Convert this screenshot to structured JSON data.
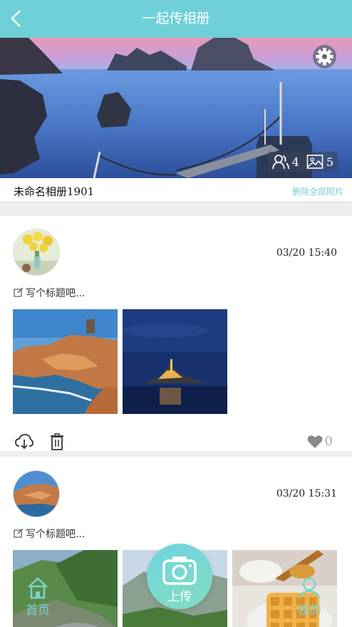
{
  "header": {
    "title": "一起传相册"
  },
  "album": {
    "member_count": "4",
    "photo_count": "5",
    "name": "未命名相册1901",
    "delete_all_label": "删除全部照片"
  },
  "posts": [
    {
      "time": "03/20 15:40",
      "title_placeholder": "写个标题吧...",
      "like_count": "0"
    },
    {
      "time": "03/20 15:31",
      "title_placeholder": "写个标题吧..."
    }
  ],
  "bottom_nav": {
    "home_label": "首页",
    "upload_label": "上传",
    "mine_label": "我的"
  },
  "colors": {
    "accent": "#6fd0d8",
    "link": "#7cc9d6",
    "like_gray": "#aaaaaa"
  }
}
